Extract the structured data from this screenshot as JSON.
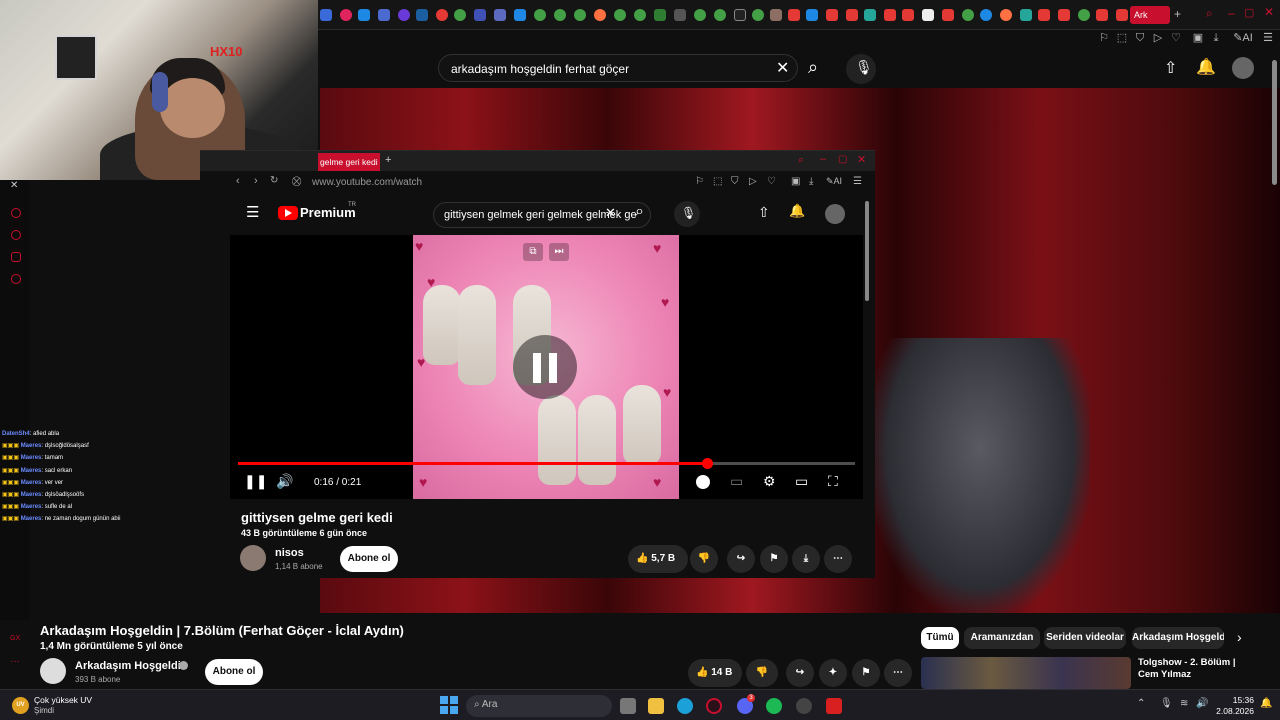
{
  "webcam": {
    "sign": "HX10"
  },
  "outer_header": {
    "tab_label": "Ark",
    "search_value": "arkadaşım hoşgeldin ferhat göçer"
  },
  "chat": [
    {
      "user": "DatenSh4",
      "msg": ": afied abla"
    },
    {
      "user": "Maeres",
      "msg": ": dşlsoğldösalşasf"
    },
    {
      "user": "Maeres",
      "msg": ": tamam"
    },
    {
      "user": "Maeres",
      "msg": ": sacl erkan"
    },
    {
      "user": "Maeres",
      "msg": ": ver ver"
    },
    {
      "user": "Maeres",
      "msg": ": dşlsöadlşsoöfs"
    },
    {
      "user": "Maeres",
      "msg": ": sufle de al"
    },
    {
      "user": "Maeres",
      "msg": ": ne zaman dogum günün abii"
    }
  ],
  "inner_window": {
    "tab_title": "gelme geri kedi",
    "url": "www.youtube.com/watch",
    "logo": "Premium",
    "logo_badge": "TR",
    "search_value": "gittiysen gelmek geri gelmek gelmek ge",
    "player": {
      "time": "0:16 / 0:21",
      "progress": 0.76
    },
    "video_title": "gittiysen gelme geri kedi",
    "video_meta": "43 B görüntüleme  6 gün önce",
    "channel": "nisos",
    "subscribers": "1,14 B abone",
    "subscribe": "Abone ol",
    "likes": "5,7 B"
  },
  "main_video": {
    "title": "Arkadaşım Hoşgeldin | 7.Bölüm (Ferhat Göçer - İclal Aydın)",
    "meta": "1,4 Mn görüntüleme  5 yıl önce",
    "channel": "Arkadaşım Hoşgeldin",
    "subscribers": "393 B abone",
    "subscribe": "Abone ol",
    "likes": "14 B",
    "chips": [
      "Tümü",
      "Aramanızdan",
      "Seriden videolar",
      "Arkadaşım Hoşgeldi"
    ],
    "rec_title": "Tolgshow - 2. Bölüm | Cem Yılmaz"
  },
  "taskbar": {
    "weather_title": "Çok yüksek UV",
    "weather_sub": "Şimdi",
    "weather_badge": "UV",
    "search_placeholder": "Ara",
    "time": "15:36",
    "date": "2.08.2026",
    "discord_badge": "3"
  },
  "colors": {
    "accent": "#c8102e",
    "yt_red": "#ff0000",
    "chat_user": "#6a8bff"
  }
}
